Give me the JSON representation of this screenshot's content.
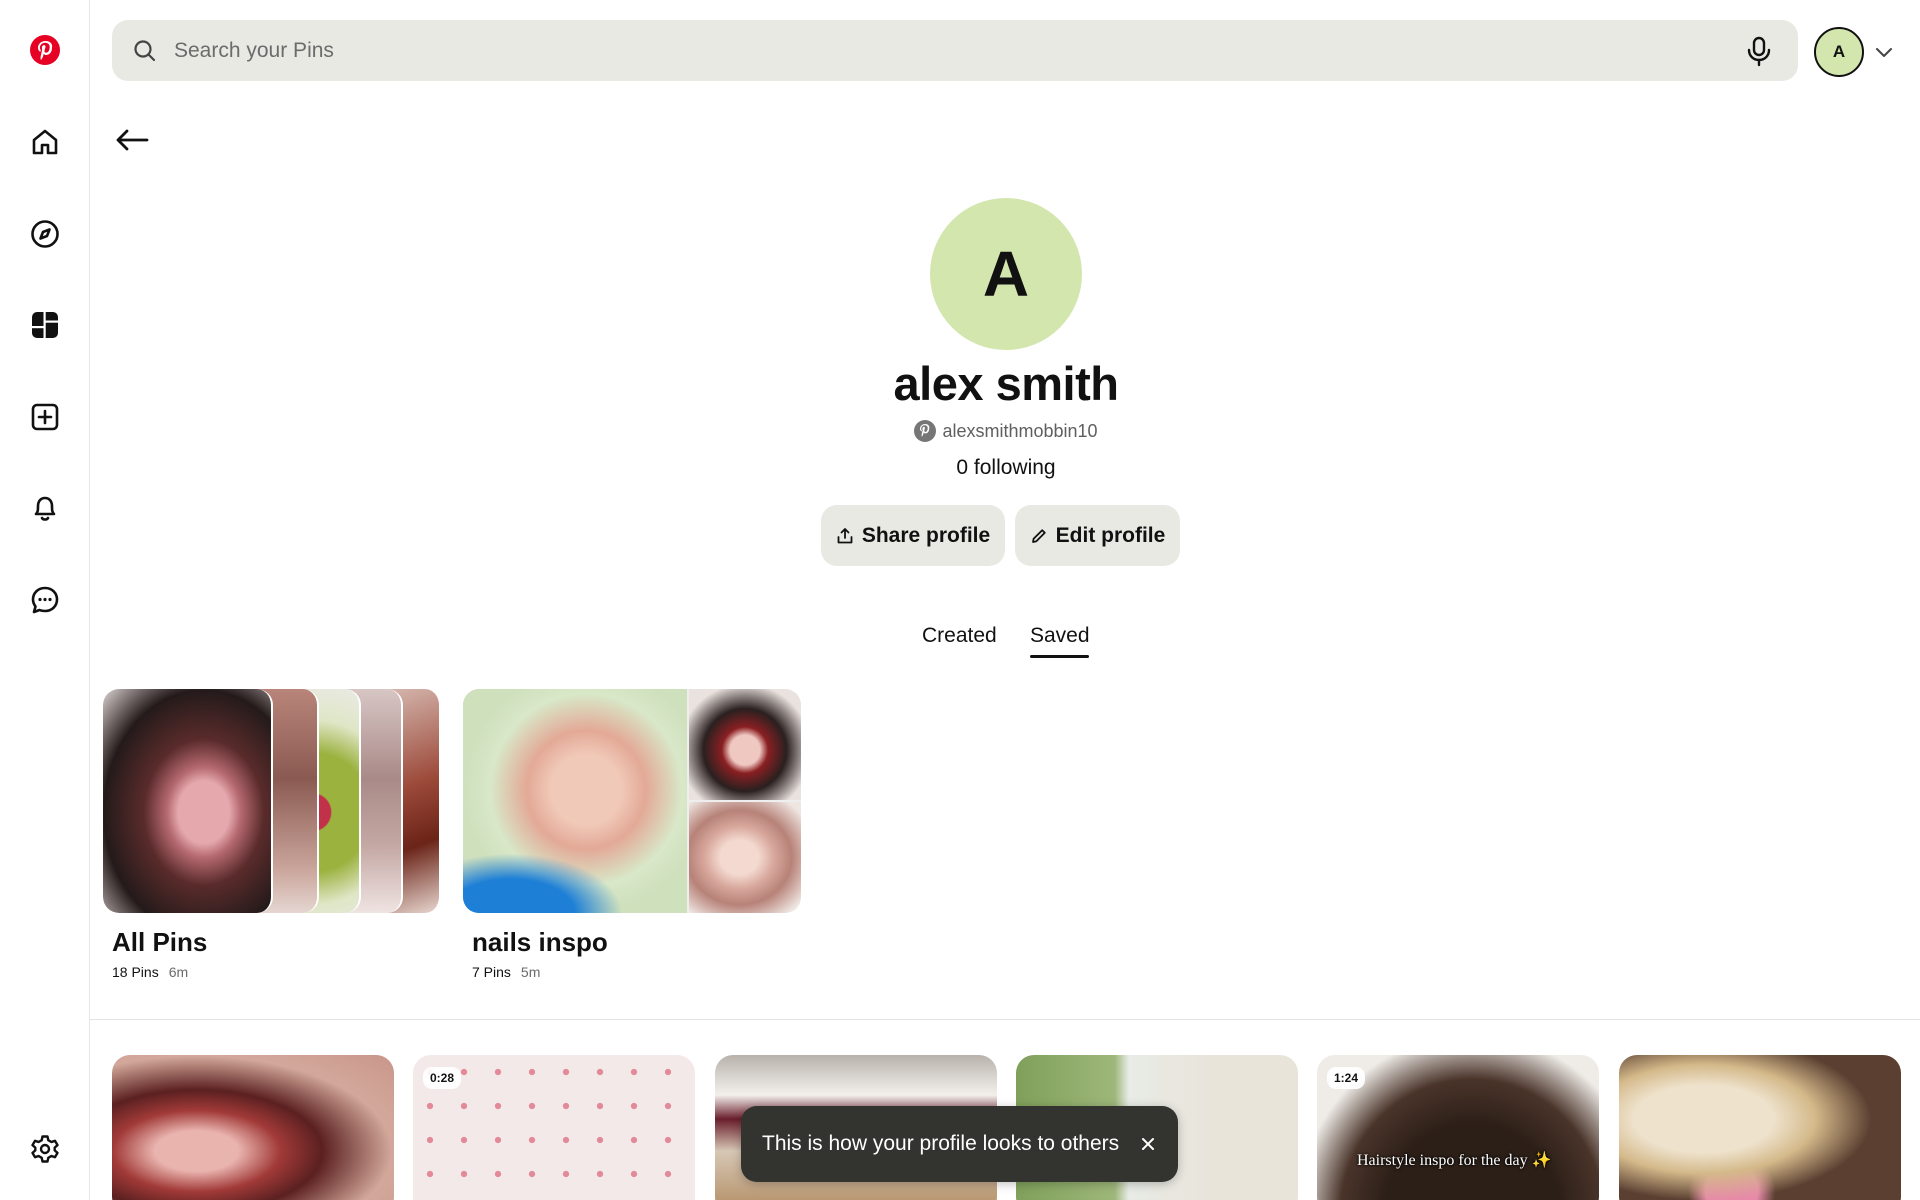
{
  "search": {
    "placeholder": "Search your Pins"
  },
  "account": {
    "initial": "A"
  },
  "profile": {
    "initial": "A",
    "name": "alex smith",
    "handle": "alexsmithmobbin10",
    "following": "0 following",
    "share_label": "Share profile",
    "edit_label": "Edit profile"
  },
  "tabs": [
    {
      "label": "Created",
      "active": false
    },
    {
      "label": "Saved",
      "active": true
    }
  ],
  "boards": [
    {
      "title": "All Pins",
      "count": "18 Pins",
      "age": "6m"
    },
    {
      "title": "nails inspo",
      "count": "7 Pins",
      "age": "5m"
    }
  ],
  "pins": [
    {
      "badge": "",
      "caption": ""
    },
    {
      "badge": "0:28",
      "caption": ""
    },
    {
      "badge": "",
      "caption": ""
    },
    {
      "badge": "",
      "caption": ""
    },
    {
      "badge": "1:24",
      "caption": "Hairstyle inspo for the day ✨"
    },
    {
      "badge": "",
      "caption": ""
    }
  ],
  "toast": {
    "message": "This is how your profile looks to others"
  },
  "colors": {
    "brand": "#e60023",
    "avatar_bg": "#d3e6ae",
    "surface": "#e9e9e4",
    "toast_bg": "#33332f"
  },
  "icons": {
    "rail": [
      "pinterest-logo",
      "home-icon",
      "explore-icon",
      "boards-icon",
      "create-icon",
      "bell-icon",
      "messages-icon",
      "settings-icon"
    ],
    "search": "search-icon",
    "mic": "microphone-icon"
  }
}
